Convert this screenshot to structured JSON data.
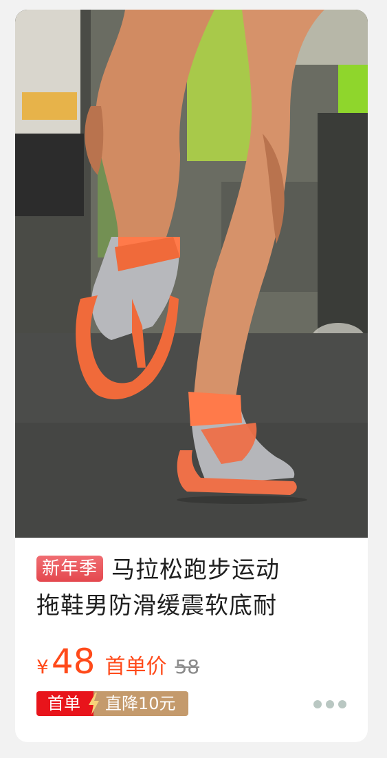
{
  "product": {
    "image_alt": "runner wearing orange flip-flop sandals with grey toe socks",
    "tag": "新年季",
    "title_line1": "马拉松跑步运动",
    "title_line2": "拖鞋男防滑缓震软底耐"
  },
  "price": {
    "currency": "¥",
    "amount": "48",
    "label": "首单价",
    "original": "58"
  },
  "coupon": {
    "left": "首单",
    "right": "直降10元"
  },
  "colors": {
    "accent": "#ff4a1a",
    "tag_red": "#e4484e",
    "coupon_red": "#e8141b",
    "coupon_gold": "#c49a6c"
  },
  "icons": {
    "bolt": "lightning-bolt-icon",
    "more": "more-dots-icon"
  }
}
